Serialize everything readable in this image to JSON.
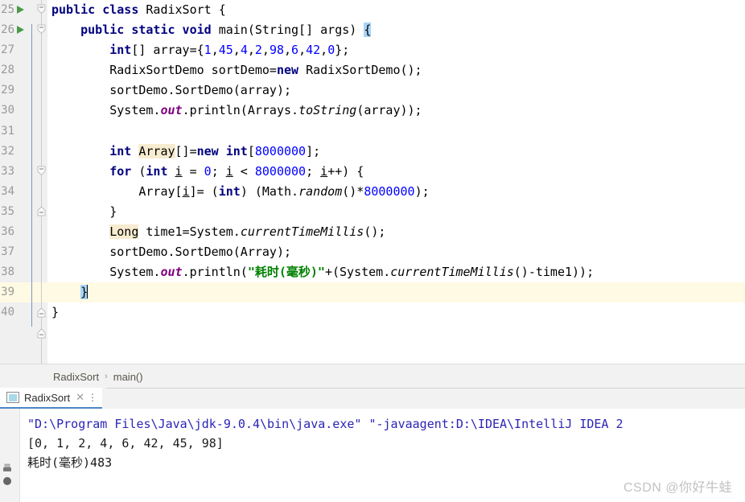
{
  "editor": {
    "line_numbers": [
      "25",
      "26",
      "27",
      "28",
      "29",
      "30",
      "31",
      "32",
      "33",
      "34",
      "35",
      "36",
      "37",
      "38",
      "39",
      "40"
    ],
    "lines": [
      {
        "n": "25",
        "run": true,
        "fold": "collapse-top",
        "current": false
      },
      {
        "n": "26",
        "run": true,
        "fold": "collapse-nested",
        "current": false
      },
      {
        "n": "27",
        "run": false,
        "fold": "",
        "current": false
      },
      {
        "n": "28",
        "run": false,
        "fold": "",
        "current": false
      },
      {
        "n": "29",
        "run": false,
        "fold": "",
        "current": false
      },
      {
        "n": "30",
        "run": false,
        "fold": "",
        "current": false
      },
      {
        "n": "31",
        "run": false,
        "fold": "",
        "current": false
      },
      {
        "n": "32",
        "run": false,
        "fold": "",
        "current": false
      },
      {
        "n": "33",
        "run": false,
        "fold": "collapse-top",
        "current": false
      },
      {
        "n": "34",
        "run": false,
        "fold": "",
        "current": false
      },
      {
        "n": "35",
        "run": false,
        "fold": "collapse-end",
        "current": false
      },
      {
        "n": "36",
        "run": false,
        "fold": "",
        "current": false
      },
      {
        "n": "37",
        "run": false,
        "fold": "",
        "current": false
      },
      {
        "n": "38",
        "run": false,
        "fold": "",
        "current": false
      },
      {
        "n": "39",
        "run": false,
        "fold": "collapse-end",
        "current": true
      },
      {
        "n": "40",
        "run": false,
        "fold": "collapse-end",
        "current": false
      }
    ],
    "code": {
      "l25_kw_public": "public",
      "l25_kw_class": "class",
      "l25_name": "RadixSort",
      "l25_brace": "{",
      "l26_kw": "public static void",
      "l26_rest": "main(String[] args) ",
      "l26_brace": "{",
      "l27_kw_int": "int",
      "l27_a": "[] array={",
      "l27_n1": "1",
      "l27_n2": "45",
      "l27_n3": "4",
      "l27_n4": "2",
      "l27_n5": "98",
      "l27_n6": "6",
      "l27_n7": "42",
      "l27_n8": "0",
      "l27_end": "};",
      "l28_a": "RadixSortDemo sortDemo=",
      "l28_kw": "new",
      "l28_b": " RadixSortDemo();",
      "l29": "sortDemo.SortDemo(array);",
      "l30_a": "System.",
      "l30_out": "out",
      "l30_b": ".println(Arrays.",
      "l30_ts": "toString",
      "l30_c": "(array));",
      "l31": "",
      "l32_kw_int": "int",
      "l32_arr": "Array",
      "l32_a": "[]=",
      "l32_kw_new": "new",
      "l32_kw_int2": "int",
      "l32_b": "[",
      "l32_num": "8000000",
      "l32_c": "];",
      "l33_kw_for": "for",
      "l33_a": " (",
      "l33_kw_int": "int",
      "l33_i1": "i",
      "l33_b": " = ",
      "l33_n0": "0",
      "l33_c": "; ",
      "l33_i2": "i",
      "l33_d": " < ",
      "l33_n1": "8000000",
      "l33_e": "; ",
      "l33_i3": "i",
      "l33_f": "++) {",
      "l34_a": "Array[",
      "l34_i": "i",
      "l34_b": "]= (",
      "l34_kw_int": "int",
      "l34_c": ") (Math.",
      "l34_rand": "random",
      "l34_d": "()*",
      "l34_num": "8000000",
      "l34_e": ");",
      "l35": "}",
      "l36_long": "Long",
      "l36_a": " time1=System.",
      "l36_ctm": "currentTimeMillis",
      "l36_b": "();",
      "l37": "sortDemo.SortDemo(Array);",
      "l38_a": "System.",
      "l38_out": "out",
      "l38_b": ".println(",
      "l38_str": "\"耗时(毫秒)\"",
      "l38_c": "+(System.",
      "l38_ctm": "currentTimeMillis",
      "l38_d": "()-time1));",
      "l39": "}",
      "l40": "}"
    }
  },
  "breadcrumb": {
    "class_name": "RadixSort",
    "separator": "›",
    "method_name": "main()"
  },
  "run_window": {
    "tab_label": "RadixSort",
    "tab_close": "✕",
    "tab_more": "⋮",
    "console_lines": [
      {
        "text": "\"D:\\Program Files\\Java\\jdk-9.0.4\\bin\\java.exe\" \"-javaagent:D:\\IDEA\\IntelliJ IDEA 2",
        "kind": "cmd"
      },
      {
        "text": "[0, 1, 2, 4, 6, 42, 45, 98]",
        "kind": "out"
      },
      {
        "text": "耗时(毫秒)483",
        "kind": "out"
      }
    ]
  },
  "watermark": {
    "text": "CSDN @你好牛蛙"
  },
  "colors": {
    "keyword": "#000080",
    "number": "#0000ff",
    "string": "#008000",
    "static_field": "#800080",
    "gutter_bg": "#f0f0f0",
    "current_line": "#fffae3",
    "identifier_highlight": "#f7ecd0",
    "brace_match": "#a8d3f7",
    "run_marker": "#4a9a4a",
    "console_cmd": "#2b25b5",
    "tab_underline": "#4a86c8"
  }
}
